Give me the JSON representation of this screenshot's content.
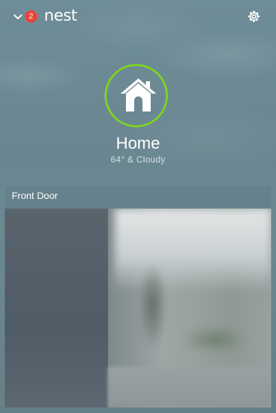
{
  "header": {
    "notification_count": "2",
    "logo_text": "nest",
    "menu_icon": "chevron-down-icon",
    "settings_icon": "gear-icon"
  },
  "home": {
    "title": "Home",
    "subtitle": "64° & Cloudy",
    "icon": "home-icon",
    "ring_color": "#7ed321"
  },
  "camera_card": {
    "title": "Front Door"
  },
  "colors": {
    "badge": "#e8453c",
    "accent_ring": "#7ed321"
  }
}
